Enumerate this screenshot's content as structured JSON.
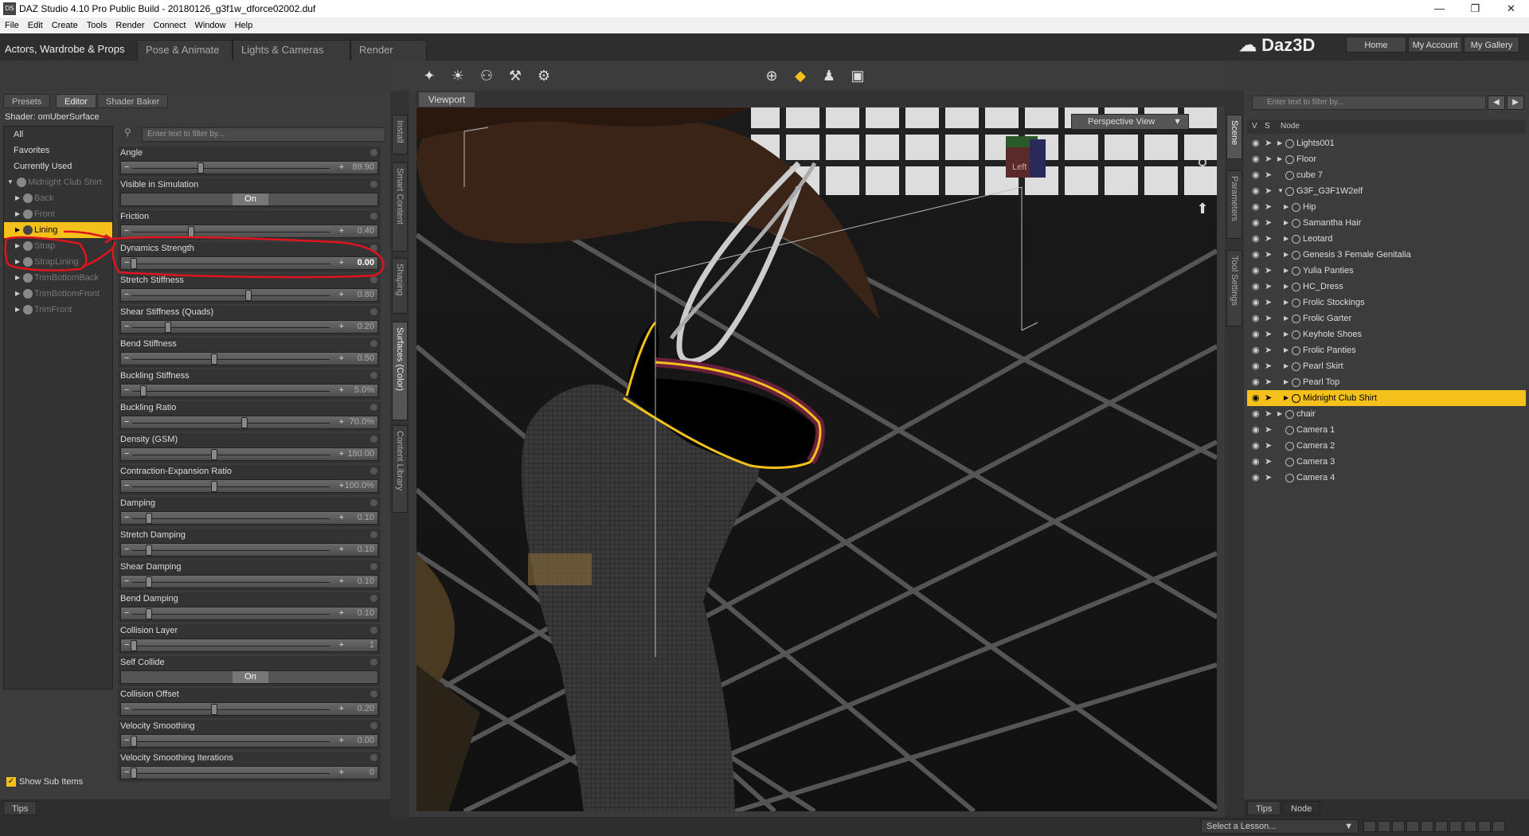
{
  "window": {
    "title": "DAZ Studio 4.10 Pro Public Build - 20180126_g3f1w_dforce02002.duf",
    "app_icon": "DS"
  },
  "menu": [
    "File",
    "Edit",
    "Create",
    "Tools",
    "Render",
    "Connect",
    "Window",
    "Help"
  ],
  "rooms": [
    "Actors, Wardrobe & Props",
    "Pose & Animate",
    "Lights & Cameras",
    "Render"
  ],
  "brand": {
    "logo": "Daz3D",
    "links": [
      "Home",
      "My Account",
      "My Gallery"
    ]
  },
  "left_panel": {
    "tabs": [
      "Presets",
      "Editor",
      "Shader Baker"
    ],
    "shader_label": "Shader: omUberSurface",
    "groups": [
      "All",
      "Favorites",
      "Currently Used"
    ],
    "object": "Midnight Club Shirt",
    "surfaces": [
      "Back",
      "Front",
      "Lining",
      "Strap",
      "StrapLining",
      "TrimBottomBack",
      "TrimBottomFront",
      "TrimFront"
    ],
    "selected_surface": "Lining",
    "filter_placeholder": "Enter text to filter by...",
    "properties": [
      {
        "name": "Angle",
        "value": "89.90",
        "level": 0.35
      },
      {
        "name": "Visible in Simulation",
        "value": "On",
        "toggle": true
      },
      {
        "name": "Friction",
        "value": "0.40",
        "level": 0.3
      },
      {
        "name": "Dynamics Strength",
        "value": "0.00",
        "level": 0.0,
        "highlight": true
      },
      {
        "name": "Stretch Stiffness",
        "value": "0.80",
        "level": 0.6
      },
      {
        "name": "Shear Stiffness (Quads)",
        "value": "0.20",
        "level": 0.18
      },
      {
        "name": "Bend Stiffness",
        "value": "0.50",
        "level": 0.42
      },
      {
        "name": "Buckling Stiffness",
        "value": "5.0%",
        "level": 0.05
      },
      {
        "name": "Buckling Ratio",
        "value": "70.0%",
        "level": 0.58
      },
      {
        "name": "Density (GSM)",
        "value": "180.00",
        "level": 0.42
      },
      {
        "name": "Contraction-Expansion Ratio",
        "value": "100.0%",
        "level": 0.42
      },
      {
        "name": "Damping",
        "value": "0.10",
        "level": 0.08
      },
      {
        "name": "Stretch Damping",
        "value": "0.10",
        "level": 0.08
      },
      {
        "name": "Shear Damping",
        "value": "0.10",
        "level": 0.08
      },
      {
        "name": "Bend Damping",
        "value": "0.10",
        "level": 0.08
      },
      {
        "name": "Collision Layer",
        "value": "1",
        "level": 0.0
      },
      {
        "name": "Self Collide",
        "value": "On",
        "toggle": true
      },
      {
        "name": "Collision Offset",
        "value": "0.20",
        "level": 0.42
      },
      {
        "name": "Velocity Smoothing",
        "value": "0.00",
        "level": 0.0
      },
      {
        "name": "Velocity Smoothing Iterations",
        "value": "0",
        "level": 0.0
      }
    ],
    "show_sub_items": "Show Sub Items",
    "bottom_tab": "Tips"
  },
  "left_vertical_tabs": [
    "Install",
    "Smart Content",
    "Shaping",
    "Surfaces (Color)",
    "Content Library"
  ],
  "viewport": {
    "tab": "Viewport",
    "camera": "Perspective View",
    "cube_label": "Left"
  },
  "right_vertical_tabs": [
    "Scene",
    "Parameters",
    "Tool Settings"
  ],
  "scene": {
    "filter_placeholder": "Enter text to filter by...",
    "headers": [
      "V",
      "S",
      "Node"
    ],
    "nodes": [
      {
        "label": "Lights001",
        "level": 1,
        "expand": true
      },
      {
        "label": "Floor",
        "level": 1,
        "expand": true
      },
      {
        "label": "cube 7",
        "level": 1,
        "expand": false
      },
      {
        "label": "G3F_G3F1W2elf",
        "level": 1,
        "expand": true,
        "open": true
      },
      {
        "label": "Hip",
        "level": 2,
        "expand": true
      },
      {
        "label": "Samantha Hair",
        "level": 2,
        "expand": true
      },
      {
        "label": "Leotard",
        "level": 2,
        "expand": true
      },
      {
        "label": "Genesis 3 Female Genitalia",
        "level": 2,
        "expand": true
      },
      {
        "label": "Yulia Panties",
        "level": 2,
        "expand": true
      },
      {
        "label": "HC_Dress",
        "level": 2,
        "expand": true
      },
      {
        "label": "Frolic Stockings",
        "level": 2,
        "expand": true
      },
      {
        "label": "Frolic Garter",
        "level": 2,
        "expand": true
      },
      {
        "label": "Keyhole Shoes",
        "level": 2,
        "expand": true
      },
      {
        "label": "Frolic Panties",
        "level": 2,
        "expand": true
      },
      {
        "label": "Pearl Skirt",
        "level": 2,
        "expand": true
      },
      {
        "label": "Pearl Top",
        "level": 2,
        "expand": true
      },
      {
        "label": "Midnight Club Shirt",
        "level": 2,
        "expand": true,
        "selected": true
      },
      {
        "label": "chair",
        "level": 1,
        "expand": true
      },
      {
        "label": "Camera 1",
        "level": 1,
        "expand": false
      },
      {
        "label": "Camera 2",
        "level": 1,
        "expand": false
      },
      {
        "label": "Camera 3",
        "level": 1,
        "expand": false
      },
      {
        "label": "Camera 4",
        "level": 1,
        "expand": false
      }
    ],
    "bottom_tabs": [
      "Tips",
      "Node"
    ]
  },
  "status": {
    "lesson_placeholder": "Select a Lesson..."
  },
  "colors": {
    "accent": "#f4c11b",
    "annotation": "#e0141e"
  }
}
